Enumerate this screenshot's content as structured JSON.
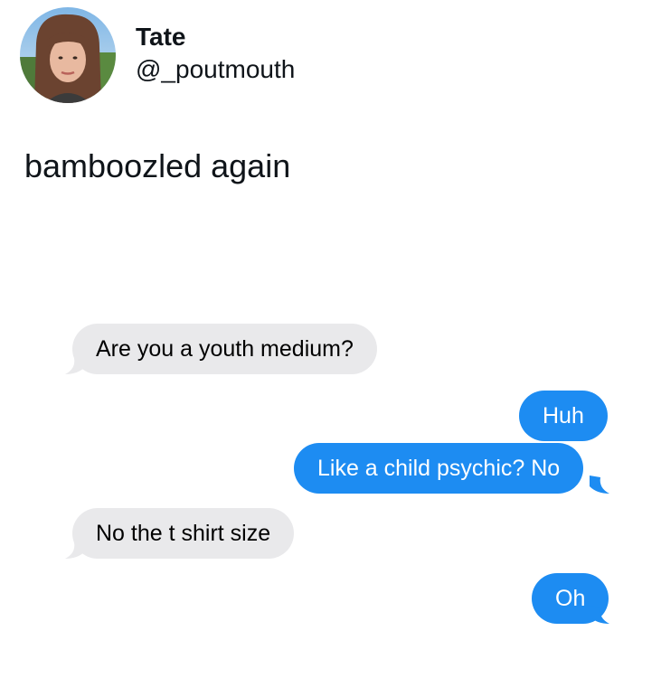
{
  "tweet": {
    "display_name": "Tate",
    "handle": "@_poutmouth",
    "text": "bamboozled again"
  },
  "messages": [
    {
      "side": "received",
      "text": "Are you a youth medium?"
    },
    {
      "side": "sent",
      "text": "Huh"
    },
    {
      "side": "sent",
      "text": "Like a child psychic? No"
    },
    {
      "side": "received",
      "text": "No the t shirt size"
    },
    {
      "side": "sent",
      "text": "Oh"
    }
  ],
  "colors": {
    "received_bubble": "#e9e9eb",
    "sent_bubble": "#1d8cf2",
    "text_primary": "#0f1419"
  }
}
